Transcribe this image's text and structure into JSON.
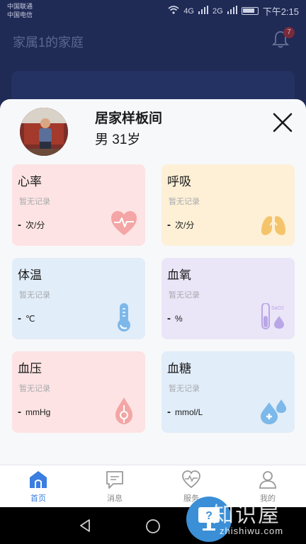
{
  "status_bar": {
    "carrier1": "中国联通",
    "carrier2": "中国电信",
    "net1": "4G",
    "net2": "2G",
    "time": "下午2:15"
  },
  "header": {
    "family_title": "家属1的家庭",
    "notification_count": "7"
  },
  "profile": {
    "name": "居家样板间",
    "info": "男 31岁"
  },
  "cards": [
    {
      "title": "心率",
      "status": "暂无记录",
      "value": "-",
      "unit": "次/分",
      "bg": "#fde3e3",
      "icon": "heart-rate-icon",
      "icon_color": "#f4a5a5"
    },
    {
      "title": "呼吸",
      "status": "暂无记录",
      "value": "-",
      "unit": "次/分",
      "bg": "#fdf0d6",
      "icon": "lungs-icon",
      "icon_color": "#f5c46a"
    },
    {
      "title": "体温",
      "status": "暂无记录",
      "value": "-",
      "unit": "℃",
      "bg": "#e1edf9",
      "icon": "thermometer-icon",
      "icon_color": "#7db8ea"
    },
    {
      "title": "血氧",
      "status": "暂无记录",
      "value": "-",
      "unit": "%",
      "bg": "#ebe5f8",
      "icon": "blood-oxygen-icon",
      "icon_color": "#b9a6e6",
      "icon_label": "SaO2"
    },
    {
      "title": "血压",
      "status": "暂无记录",
      "value": "-",
      "unit": "mmHg",
      "bg": "#fde3e3",
      "icon": "blood-pressure-icon",
      "icon_color": "#f4a5a5"
    },
    {
      "title": "血糖",
      "status": "暂无记录",
      "value": "-",
      "unit": "mmol/L",
      "bg": "#e1edf9",
      "icon": "blood-sugar-icon",
      "icon_color": "#7db8ea"
    }
  ],
  "tabs": [
    {
      "label": "首页",
      "icon": "home-icon",
      "active": true
    },
    {
      "label": "消息",
      "icon": "message-icon",
      "active": false
    },
    {
      "label": "服务",
      "icon": "heart-outline-icon",
      "active": false
    },
    {
      "label": "我的",
      "icon": "user-icon",
      "active": false
    }
  ],
  "watermark": {
    "text": "知识屋",
    "url": "zhishiwu.com",
    "registered": "®"
  },
  "colors": {
    "accent": "#3b7de0",
    "header_bg": "#1f2a55"
  }
}
